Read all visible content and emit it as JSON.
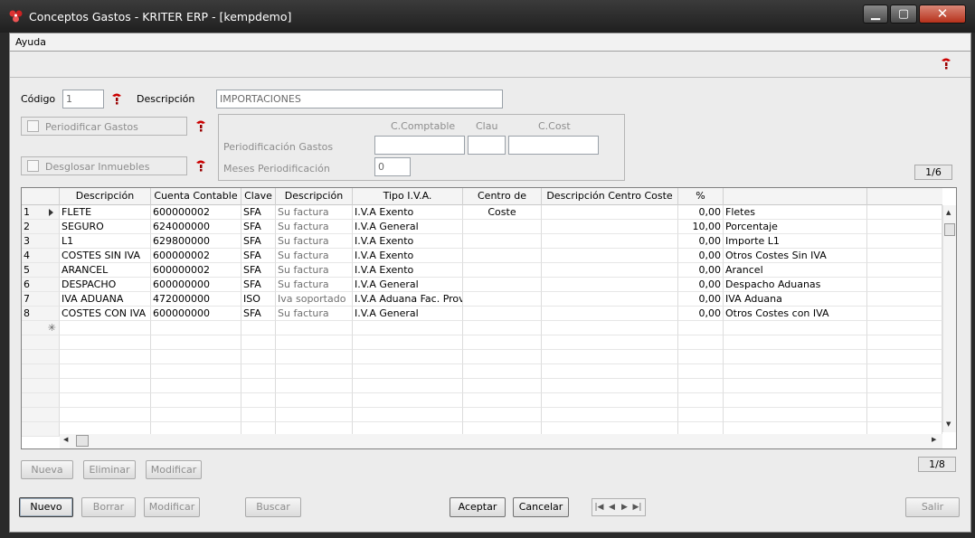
{
  "window": {
    "title": "Conceptos Gastos - KRITER ERP - [kempdemo]",
    "min": "▁",
    "max": "▢",
    "close": "✕"
  },
  "menu": {
    "help": "Ayuda"
  },
  "form": {
    "codigo_label": "Código",
    "codigo_value": "1",
    "descripcion_label": "Descripción",
    "descripcion_value": "IMPORTACIONES",
    "periodificar_label": "Periodificar Gastos",
    "desglosar_label": "Desglosar Inmuebles",
    "col_ccomptable": "C.Comptable",
    "col_clau": "Clau",
    "col_ccost": "C.Cost",
    "periodificacion_label": "Periodificación Gastos",
    "meses_label": "Meses Periodificación",
    "meses_value": "0",
    "counter_top": "1/6"
  },
  "grid": {
    "columns": [
      "Descripción",
      "Cuenta Contable",
      "Clave",
      "Descripción",
      "Tipo I.V.A.",
      "Centro de Coste",
      "Descripción Centro Coste",
      "%",
      ""
    ],
    "rows": [
      {
        "n": "1",
        "desc": "FLETE",
        "cuenta": "600000002",
        "clave": "SFA",
        "desc2": "Su factura",
        "iva": "I.V.A Exento",
        "pct": "0,00",
        "extra": "Fletes"
      },
      {
        "n": "2",
        "desc": "SEGURO",
        "cuenta": "624000000",
        "clave": "SFA",
        "desc2": "Su factura",
        "iva": "I.V.A General",
        "pct": "10,00",
        "extra": "Porcentaje"
      },
      {
        "n": "3",
        "desc": "L1",
        "cuenta": "629800000",
        "clave": "SFA",
        "desc2": "Su factura",
        "iva": "I.V.A Exento",
        "pct": "0,00",
        "extra": "Importe L1"
      },
      {
        "n": "4",
        "desc": "COSTES SIN IVA",
        "cuenta": "600000002",
        "clave": "SFA",
        "desc2": "Su factura",
        "iva": "I.V.A Exento",
        "pct": "0,00",
        "extra": "Otros Costes Sin IVA"
      },
      {
        "n": "5",
        "desc": "ARANCEL",
        "cuenta": "600000002",
        "clave": "SFA",
        "desc2": "Su factura",
        "iva": "I.V.A Exento",
        "pct": "0,00",
        "extra": "Arancel"
      },
      {
        "n": "6",
        "desc": "DESPACHO",
        "cuenta": "600000000",
        "clave": "SFA",
        "desc2": "Su factura",
        "iva": "I.V.A General",
        "pct": "0,00",
        "extra": "Despacho Aduanas"
      },
      {
        "n": "7",
        "desc": "IVA ADUANA",
        "cuenta": "472000000",
        "clave": "ISO",
        "desc2": "Iva soportado",
        "iva": "I.V.A Aduana Fac. Prov.",
        "pct": "0,00",
        "extra": "IVA Aduana"
      },
      {
        "n": "8",
        "desc": "COSTES CON IVA",
        "cuenta": "600000000",
        "clave": "SFA",
        "desc2": "Su factura",
        "iva": "I.V.A General",
        "pct": "0,00",
        "extra": "Otros Costes con IVA"
      }
    ],
    "new_row_marker": "✳",
    "counter": "1/8"
  },
  "grid_buttons": {
    "nueva": "Nueva",
    "eliminar": "Eliminar",
    "modificar": "Modificar"
  },
  "bottom_buttons": {
    "nuevo": "Nuevo",
    "borrar": "Borrar",
    "modificar": "Modificar",
    "buscar": "Buscar",
    "aceptar": "Aceptar",
    "cancelar": "Cancelar",
    "salir": "Salir"
  },
  "nav": {
    "first": "|◀",
    "prev": "◀",
    "next": "▶",
    "last": "▶|"
  }
}
